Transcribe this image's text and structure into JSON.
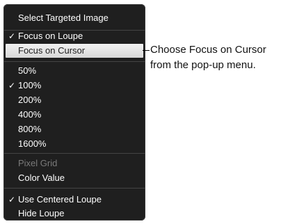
{
  "menu": {
    "items": [
      {
        "label": "Select Targeted Image",
        "checked": false,
        "disabled": false
      },
      {
        "label": "Focus on Loupe",
        "checked": true,
        "disabled": false
      },
      {
        "label": "Focus on Cursor",
        "checked": false,
        "disabled": false,
        "highlighted": true
      },
      {
        "label": "50%",
        "checked": false,
        "disabled": false
      },
      {
        "label": "100%",
        "checked": true,
        "disabled": false
      },
      {
        "label": "200%",
        "checked": false,
        "disabled": false
      },
      {
        "label": "400%",
        "checked": false,
        "disabled": false
      },
      {
        "label": "800%",
        "checked": false,
        "disabled": false
      },
      {
        "label": "1600%",
        "checked": false,
        "disabled": false
      },
      {
        "label": "Pixel Grid",
        "checked": false,
        "disabled": true
      },
      {
        "label": "Color Value",
        "checked": false,
        "disabled": false
      },
      {
        "label": "Use Centered Loupe",
        "checked": true,
        "disabled": false
      },
      {
        "label": "Hide Loupe",
        "checked": false,
        "disabled": false
      }
    ],
    "check_mark": "✓"
  },
  "callout": {
    "line1": "Choose Focus on Cursor",
    "line2": "from the pop-up menu."
  },
  "colors": {
    "menu_background": "#1f1f1f",
    "highlight_background": "#e6e6e6",
    "disabled_text": "#7a7a7a"
  }
}
